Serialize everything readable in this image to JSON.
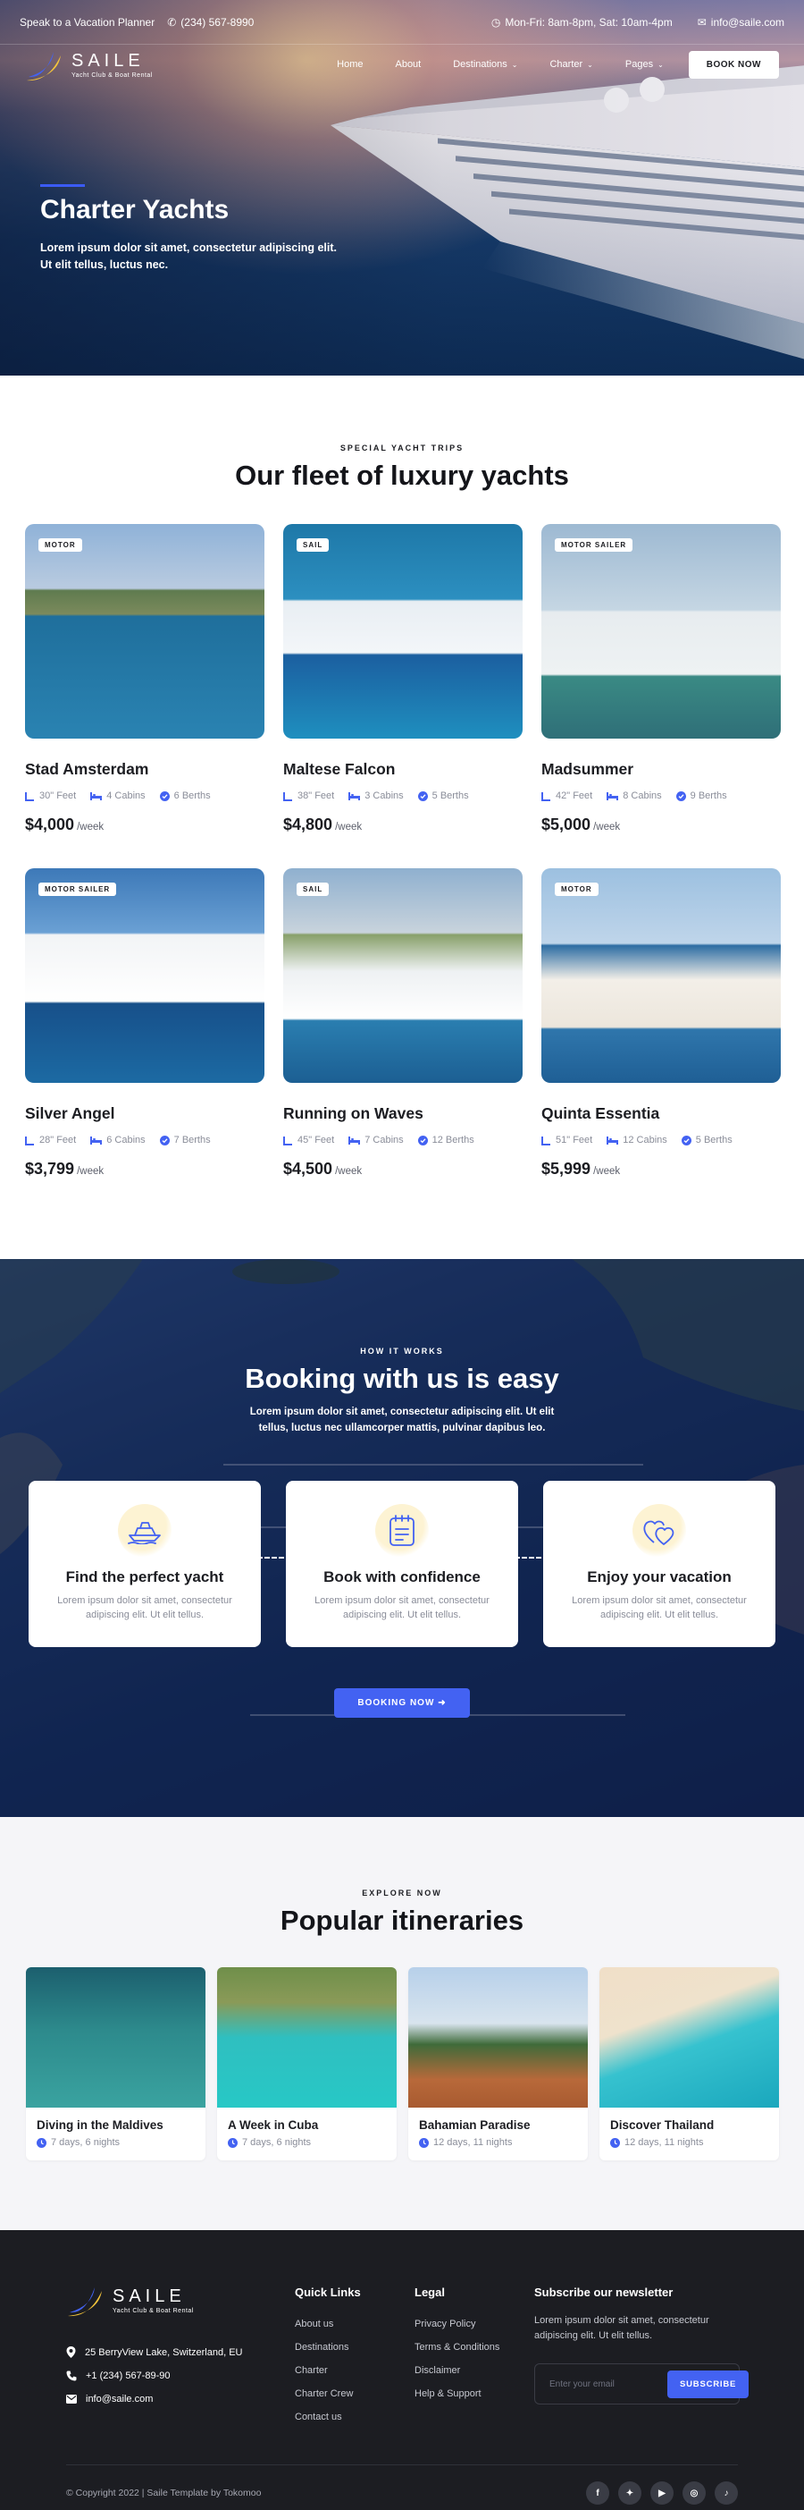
{
  "topbar": {
    "speak": "Speak to a Vacation Planner",
    "phone": "(234) 567-8990",
    "hours": "Mon-Fri: 8am-8pm, Sat: 10am-4pm",
    "email": "info@saile.com"
  },
  "brand": {
    "name": "SAILE",
    "tagline": "Yacht Club & Boat Rental"
  },
  "nav": {
    "items": [
      "Home",
      "About",
      "Destinations",
      "Charter",
      "Pages"
    ],
    "book_label": "BOOK NOW"
  },
  "hero": {
    "title": "Charter Yachts",
    "subtitle": "Lorem ipsum dolor sit amet, consectetur adipiscing elit. Ut elit tellus, luctus nec."
  },
  "fleet": {
    "eyebrow": "SPECIAL YACHT TRIPS",
    "title": "Our fleet of luxury yachts",
    "per": "/week",
    "yachts": [
      {
        "tag": "MOTOR",
        "name": "Stad Amsterdam",
        "length": "30\" Feet",
        "cabins": "4 Cabins",
        "berths": "6 Berths",
        "price": "$4,000"
      },
      {
        "tag": "SAIL",
        "name": "Maltese Falcon",
        "length": "38\" Feet",
        "cabins": "3 Cabins",
        "berths": "5 Berths",
        "price": "$4,800"
      },
      {
        "tag": "MOTOR SAILER",
        "name": "Madsummer",
        "length": "42\" Feet",
        "cabins": "8 Cabins",
        "berths": "9 Berths",
        "price": "$5,000"
      },
      {
        "tag": "MOTOR SAILER",
        "name": "Silver Angel",
        "length": "28\" Feet",
        "cabins": "6 Cabins",
        "berths": "7 Berths",
        "price": "$3,799"
      },
      {
        "tag": "SAIL",
        "name": "Running on Waves",
        "length": "45\" Feet",
        "cabins": "7 Cabins",
        "berths": "12 Berths",
        "price": "$4,500"
      },
      {
        "tag": "MOTOR",
        "name": "Quinta Essentia",
        "length": "51\" Feet",
        "cabins": "12 Cabins",
        "berths": "5 Berths",
        "price": "$5,999"
      }
    ]
  },
  "how": {
    "eyebrow": "HOW IT WORKS",
    "title": "Booking with us is easy",
    "subtitle": "Lorem ipsum dolor sit amet, consectetur adipiscing elit. Ut elit tellus, luctus nec ullamcorper mattis, pulvinar dapibus leo.",
    "steps": [
      {
        "title": "Find the perfect yacht",
        "text": "Lorem ipsum dolor sit amet, consectetur adipiscing elit. Ut elit tellus."
      },
      {
        "title": "Book with confidence",
        "text": "Lorem ipsum dolor sit amet, consectetur adipiscing elit. Ut elit tellus."
      },
      {
        "title": "Enjoy your vacation",
        "text": "Lorem ipsum dolor sit amet, consectetur adipiscing elit. Ut elit tellus."
      }
    ],
    "button": "BOOKING NOW"
  },
  "itineraries": {
    "eyebrow": "EXPLORE NOW",
    "title": "Popular itineraries",
    "items": [
      {
        "name": "Diving in the Maldives",
        "duration": "7 days, 6 nights"
      },
      {
        "name": "A Week in Cuba",
        "duration": "7 days, 6 nights"
      },
      {
        "name": "Bahamian Paradise",
        "duration": "12 days, 11 nights"
      },
      {
        "name": "Discover Thailand",
        "duration": "12 days, 11 nights"
      }
    ]
  },
  "footer": {
    "address": "25 BerryView Lake, Switzerland, EU",
    "phone": "+1 (234) 567-89-90",
    "email": "info@saile.com",
    "quick_links": {
      "title": "Quick Links",
      "items": [
        "About us",
        "Destinations",
        "Charter",
        "Charter Crew",
        "Contact us"
      ]
    },
    "legal": {
      "title": "Legal",
      "items": [
        "Privacy Policy",
        "Terms & Conditions",
        "Disclaimer",
        "Help & Support"
      ]
    },
    "newsletter": {
      "title": "Subscribe our newsletter",
      "text": "Lorem ipsum dolor sit amet, consectetur adipiscing elit. Ut elit tellus.",
      "placeholder": "Enter your email",
      "button": "SUBSCRIBE"
    },
    "copyright": "© Copyright 2022 | Saile Template by Tokomoo",
    "socials": [
      "facebook-icon",
      "twitter-icon",
      "youtube-icon",
      "instagram-icon",
      "tiktok-icon"
    ]
  }
}
